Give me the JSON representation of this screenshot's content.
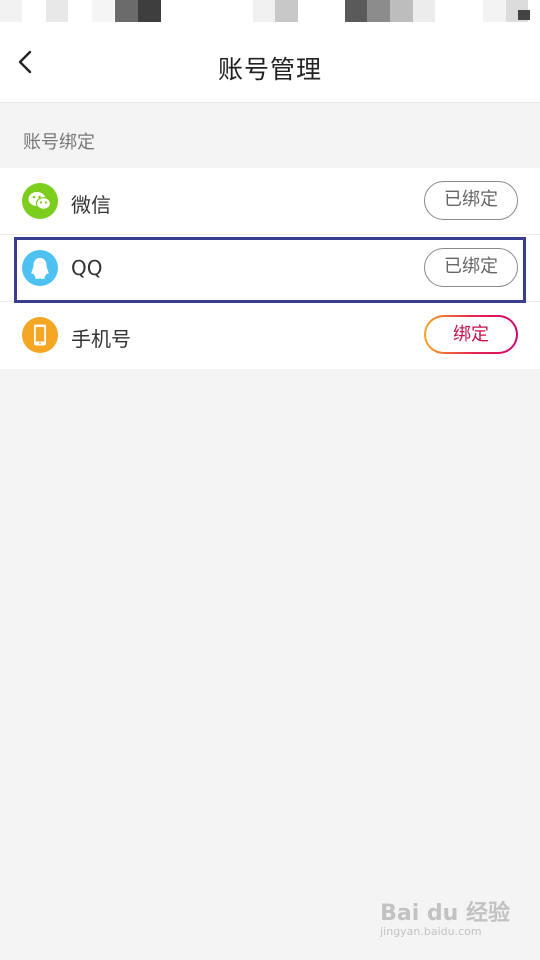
{
  "header": {
    "title": "账号管理",
    "back_icon": "chevron-left-icon"
  },
  "section": {
    "title": "账号绑定"
  },
  "accounts": [
    {
      "label": "微信",
      "icon": "wechat-icon",
      "icon_color": "#7ccd1e",
      "button_label": "已绑定",
      "bound": true
    },
    {
      "label": "QQ",
      "icon": "qq-penguin-icon",
      "icon_color": "#4ec1f3",
      "button_label": "已绑定",
      "bound": true,
      "highlighted": true
    },
    {
      "label": "手机号",
      "icon": "phone-icon",
      "icon_color": "#f5a623",
      "button_label": "绑定",
      "bound": false
    }
  ],
  "colors": {
    "highlight_border": "#3b3d8f",
    "bind_accent": "#c5114f",
    "bound_border": "#8a8a8a"
  },
  "watermark": {
    "text": "Bai du 经验",
    "sub": "jingyan.baidu.com"
  }
}
